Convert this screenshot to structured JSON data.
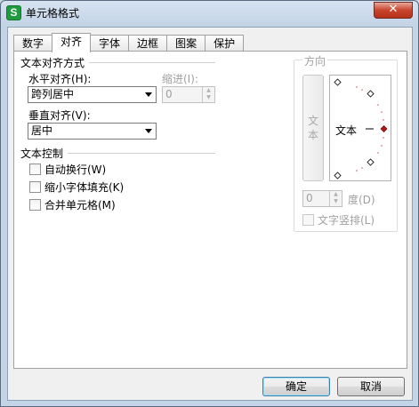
{
  "window": {
    "title": "单元格格式",
    "close_symbol": "✕",
    "app_icon_letter": "S"
  },
  "tabs": [
    {
      "label": "数字",
      "active": false
    },
    {
      "label": "对齐",
      "active": true
    },
    {
      "label": "字体",
      "active": false
    },
    {
      "label": "边框",
      "active": false
    },
    {
      "label": "图案",
      "active": false
    },
    {
      "label": "保护",
      "active": false
    }
  ],
  "alignment": {
    "section_title": "文本对齐方式",
    "horizontal_label": "水平对齐(H):",
    "horizontal_value": "跨列居中",
    "indent_label": "缩进(I):",
    "indent_value": "0",
    "vertical_label": "垂直对齐(V):",
    "vertical_value": "居中"
  },
  "text_control": {
    "section_title": "文本控制",
    "wrap_text": "自动换行(W)",
    "shrink_to_fit": "缩小字体填充(K)",
    "merge_cells": "合并单元格(M)"
  },
  "orientation": {
    "section_title": "方向",
    "vertical_text_chars": [
      "文",
      "本"
    ],
    "dial_text": "文本",
    "degree_value": "0",
    "degree_label": "度(D)",
    "vertical_stack_label": "文字竖排(L)"
  },
  "buttons": {
    "ok": "确定",
    "cancel": "取消"
  },
  "colors": {
    "dial_indicator": "#b01818",
    "close_button": "#c9442c",
    "app_icon": "#1f9a3c"
  }
}
